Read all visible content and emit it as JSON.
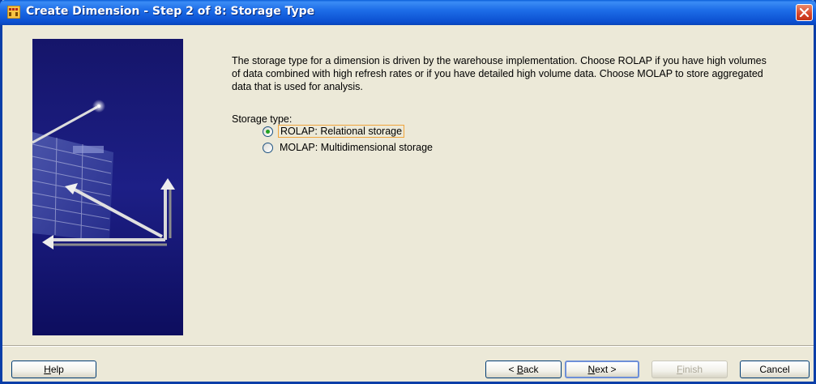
{
  "window": {
    "title": "Create Dimension - Step 2 of 8: Storage Type"
  },
  "content": {
    "description": "The storage type for a dimension is driven by the warehouse implementation. Choose ROLAP if you have high volumes of data combined with high refresh rates or if you have detailed high volume data. Choose MOLAP to store aggregated data that is used for analysis.",
    "storage_label": "Storage type:",
    "options": [
      {
        "label": "ROLAP: Relational storage",
        "selected": true
      },
      {
        "label": "MOLAP: Multidimensional storage",
        "selected": false
      }
    ]
  },
  "buttons": {
    "help": {
      "first": "H",
      "rest": "elp"
    },
    "back": {
      "pre": "< ",
      "mnemonic": "B",
      "rest": "ack"
    },
    "next": {
      "mnemonic": "N",
      "rest": "ext >"
    },
    "finish": {
      "mnemonic": "F",
      "rest": "inish"
    },
    "cancel": "Cancel"
  },
  "colors": {
    "titlebar": "#0b4fd0",
    "dialog_bg": "#ece9d8",
    "side_panel": "#1d1f86",
    "selected_radio": "#21a121",
    "focus_outline": "#f0a43c"
  },
  "icons": {
    "app": "oracle-wizard-icon",
    "close": "close-icon",
    "wizard_art": "dimension-wizard-illustration"
  }
}
